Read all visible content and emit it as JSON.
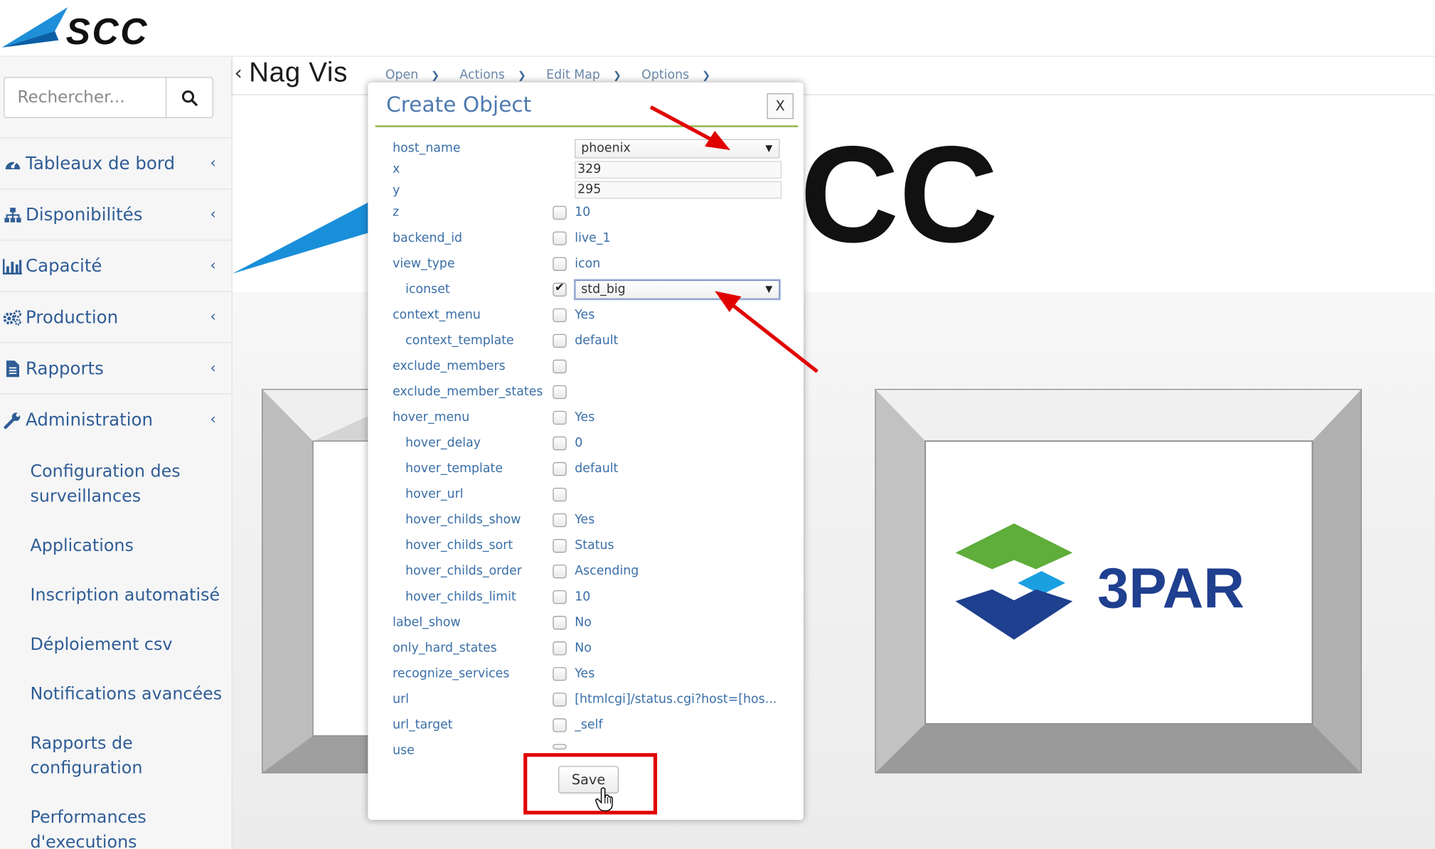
{
  "header": {
    "logo_text": "SCC"
  },
  "search": {
    "placeholder": "Rechercher..."
  },
  "nav": {
    "items": [
      {
        "label": "Tableaux de bord",
        "icon": "dashboard-icon"
      },
      {
        "label": "Disponibilités",
        "icon": "sitemap-icon"
      },
      {
        "label": "Capacité",
        "icon": "bar-chart-icon"
      },
      {
        "label": "Production",
        "icon": "gears-icon"
      },
      {
        "label": "Rapports",
        "icon": "file-text-icon"
      },
      {
        "label": "Administration",
        "icon": "wrench-icon"
      }
    ],
    "sub_items": [
      "Configuration des surveillances",
      "Applications",
      "Inscription automatisé",
      "Déploiement csv",
      "Notifications avancées",
      "Rapports de configuration",
      "Performances d'executions"
    ]
  },
  "nagvis": {
    "logo": "Nag Vis",
    "menu": [
      "Open",
      "Actions",
      "Edit Map",
      "Options"
    ]
  },
  "canvas": {
    "background_logo_text": "CC",
    "tile_logo_text": "3PAR"
  },
  "modal": {
    "title": "Create Object",
    "close_label": "X",
    "save_label": "Save",
    "fields": {
      "host_name": {
        "key": "host_name",
        "value": "phoenix"
      },
      "x": {
        "key": "x",
        "value": "329"
      },
      "y": {
        "key": "y",
        "value": "295"
      },
      "z": {
        "key": "z",
        "value": "10"
      },
      "backend_id": {
        "key": "backend_id",
        "value": "live_1"
      },
      "view_type": {
        "key": "view_type",
        "value": "icon"
      },
      "iconset": {
        "key": "iconset",
        "value": "std_big"
      },
      "context_menu": {
        "key": "context_menu",
        "value": "Yes"
      },
      "context_template": {
        "key": "context_template",
        "value": "default"
      },
      "exclude_members": {
        "key": "exclude_members",
        "value": ""
      },
      "exclude_member_states": {
        "key": "exclude_member_states",
        "value": ""
      },
      "hover_menu": {
        "key": "hover_menu",
        "value": "Yes"
      },
      "hover_delay": {
        "key": "hover_delay",
        "value": "0"
      },
      "hover_template": {
        "key": "hover_template",
        "value": "default"
      },
      "hover_url": {
        "key": "hover_url",
        "value": ""
      },
      "hover_childs_show": {
        "key": "hover_childs_show",
        "value": "Yes"
      },
      "hover_childs_sort": {
        "key": "hover_childs_sort",
        "value": "Status"
      },
      "hover_childs_order": {
        "key": "hover_childs_order",
        "value": "Ascending"
      },
      "hover_childs_limit": {
        "key": "hover_childs_limit",
        "value": "10"
      },
      "label_show": {
        "key": "label_show",
        "value": "No"
      },
      "only_hard_states": {
        "key": "only_hard_states",
        "value": "No"
      },
      "recognize_services": {
        "key": "recognize_services",
        "value": "Yes"
      },
      "url": {
        "key": "url",
        "value": "[htmlcgi]/status.cgi?host=[hos..."
      },
      "url_target": {
        "key": "url_target",
        "value": "_self"
      },
      "use": {
        "key": "use",
        "value": ""
      }
    }
  },
  "colors": {
    "accent": "#3a6fa8",
    "rule": "#95b84f",
    "annotation": "#e10000"
  }
}
